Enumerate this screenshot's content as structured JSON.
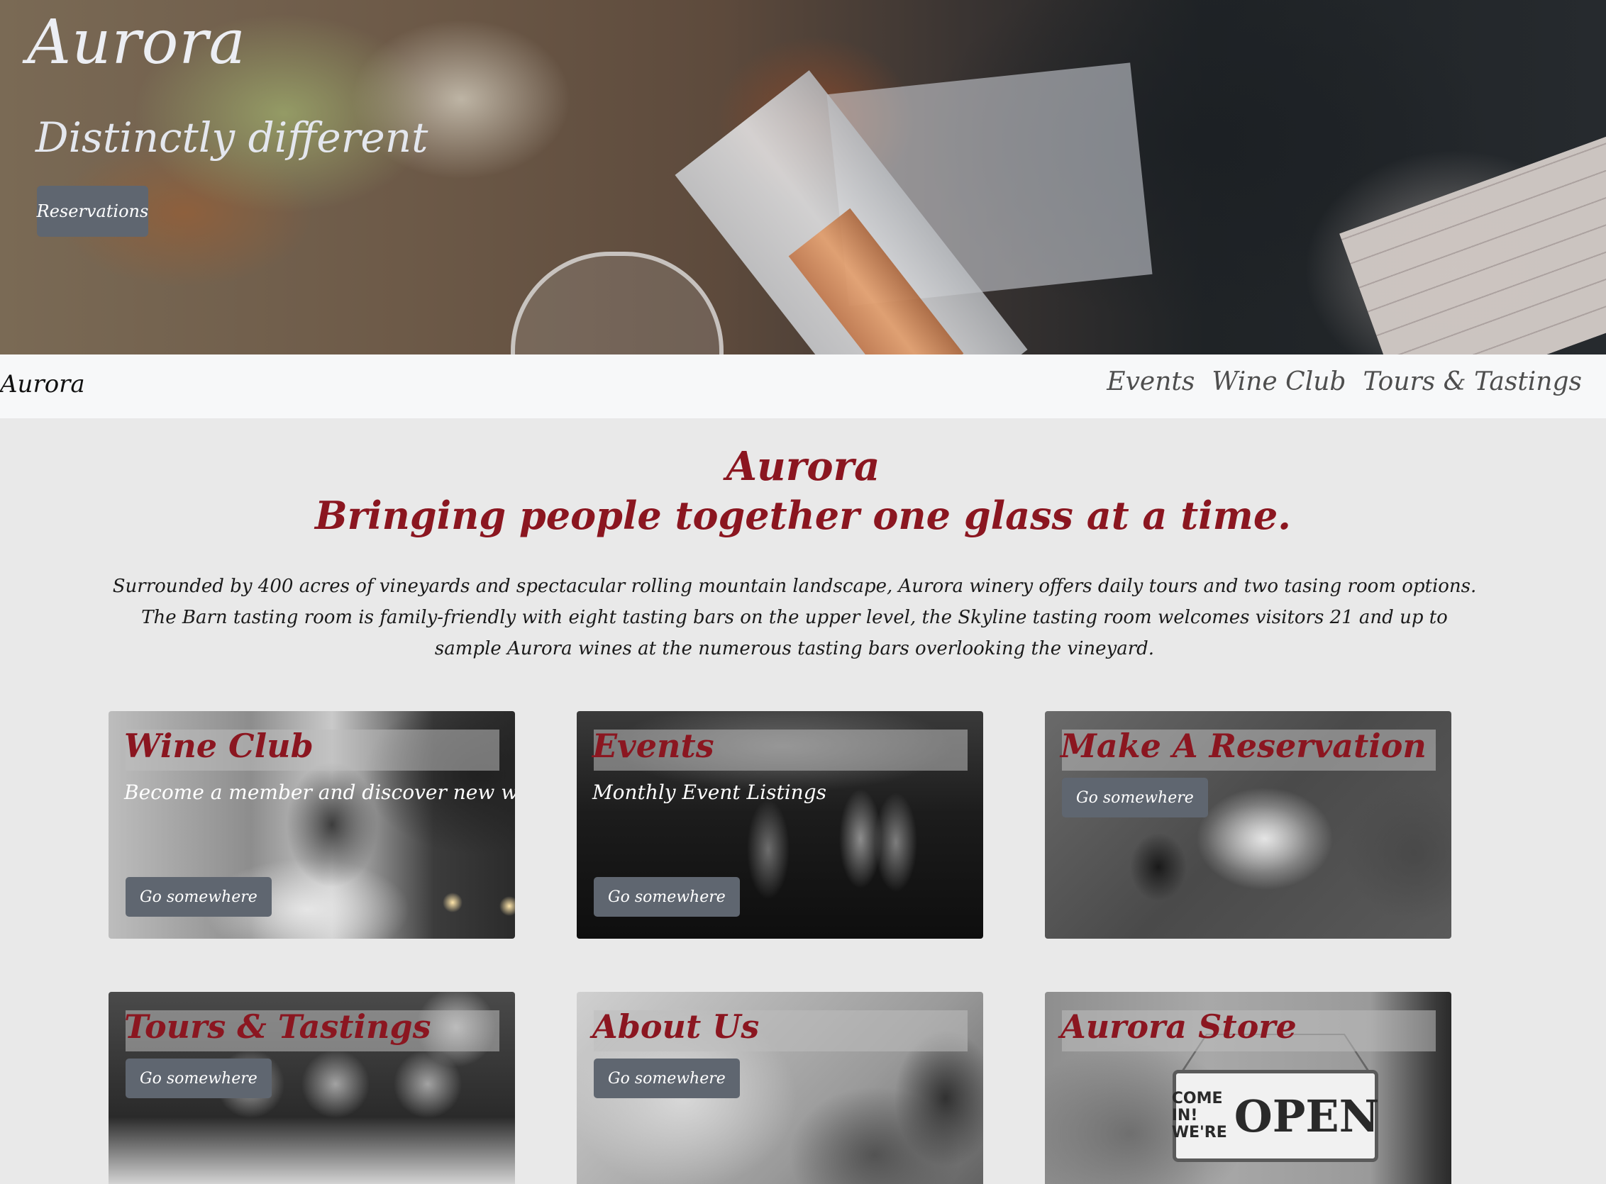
{
  "hero": {
    "brand": "Aurora",
    "tagline": "Distinctly different",
    "button_label": "Reservations"
  },
  "navbar": {
    "brand": "Aurora",
    "links": [
      "Events",
      "Wine Club",
      "Tours & Tastings"
    ]
  },
  "intro": {
    "title": "Aurora",
    "subtitle": "Bringing people together one glass at a time.",
    "text": "Surrounded by 400 acres of vineyards and spectacular rolling mountain landscape, Aurora winery offers daily tours and two tasing room options. The Barn tasting room is family-friendly with eight tasting bars on the upper level, the Skyline tasting room welcomes visitors 21 and up to sample Aurora wines at the numerous tasting bars overlooking the vineyard."
  },
  "cards": [
    {
      "title": "Wine Club",
      "text": "Become a member and discover new wines!",
      "button": "Go somewhere"
    },
    {
      "title": "Events",
      "text": "Monthly Event Listings",
      "button": "Go somewhere"
    },
    {
      "title": "Make A Reservation",
      "text": "",
      "button": "Go somewhere"
    },
    {
      "title": "Tours & Tastings",
      "text": "",
      "button": "Go somewhere"
    },
    {
      "title": "About Us",
      "text": "",
      "button": "Go somewhere"
    },
    {
      "title": "Aurora Store",
      "text": "",
      "button": ""
    }
  ],
  "store_sign": {
    "line1": "COME IN!",
    "line2": "WE'RE",
    "big": "OPEN"
  },
  "colors": {
    "accent_red": "#8b1620",
    "button_gray": "#5f6670",
    "page_bg": "#e9e9e9",
    "navbar_bg": "#f7f8f9"
  }
}
